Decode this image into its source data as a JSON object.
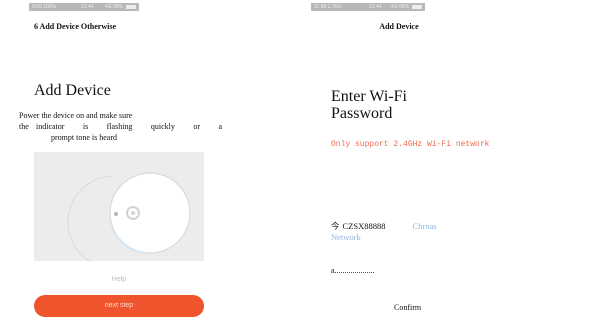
{
  "left": {
    "status": {
      "left": "9:59 100% ",
      "mid": "13:44",
      "right": "4G 99% "
    },
    "section_heading": "6 Add Device Otherwise",
    "title": "Add Device",
    "instruction_line1": "Power the device on and make sure",
    "instruction_line2_label": "the",
    "instruction_line2": "indicator is flashing quickly or a",
    "instruction_line3": "prompt  tone is heard",
    "help_label": "Help",
    "next_label": "next step"
  },
  "right": {
    "status": {
      "left": "11:58 1.7K/s ",
      "mid": "13:44",
      "right": "4G 99% "
    },
    "heading": "Add Device",
    "title": "Enter Wi-Fi Password",
    "note": "Only support 2.4GHz Wi-Fi network",
    "wifi_icon_glyph": "今",
    "ssid": "CZSX88888",
    "change_label": "Chrnas",
    "change_label_line2": "Network",
    "password_value": "a....................",
    "confirm_label": "Confirm"
  },
  "colors": {
    "accent": "#f0542d",
    "note": "#f06a50",
    "link": "#8fb3de"
  },
  "icons": [
    "wifi-icon",
    "battery-icon"
  ]
}
